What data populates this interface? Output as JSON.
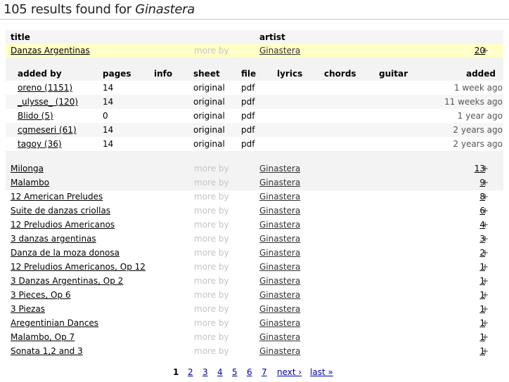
{
  "page": {
    "heading_prefix": "105 results found for ",
    "heading_query": "Ginastera"
  },
  "columns": {
    "title": "title",
    "artist": "artist"
  },
  "results": [
    {
      "title": "Danzas Argentinas",
      "more": "more by",
      "artist": "Ginastera",
      "count": "20",
      "plus": "+",
      "selected": true
    },
    {
      "title": "Milonga",
      "more": "more by",
      "artist": "Ginastera",
      "count": "13",
      "plus": "+"
    },
    {
      "title": "Malambo",
      "more": "more by",
      "artist": "Ginastera",
      "count": "9",
      "plus": "+"
    },
    {
      "title": "12 American Preludes",
      "more": "more by",
      "artist": "Ginastera",
      "count": "8",
      "plus": "+"
    },
    {
      "title": "Suite de danzas criollas",
      "more": "more by",
      "artist": "Ginastera",
      "count": "6",
      "plus": "+"
    },
    {
      "title": "12 Preludios Americanos",
      "more": "more by",
      "artist": "Ginastera",
      "count": "4",
      "plus": "+"
    },
    {
      "title": "3 danzas argentinas",
      "more": "more by",
      "artist": "Ginastera",
      "count": "3",
      "plus": "+"
    },
    {
      "title": "Danza de la moza donosa",
      "more": "more by",
      "artist": "Ginastera",
      "count": "2",
      "plus": "+"
    },
    {
      "title": "12 Preludios Americanos, Op 12",
      "more": "more by",
      "artist": "Ginastera",
      "count": "1",
      "plus": "+"
    },
    {
      "title": "3 Danzas Argentinas, Op 2",
      "more": "more by",
      "artist": "Ginastera",
      "count": "1",
      "plus": "+"
    },
    {
      "title": "3 Pieces, Op 6",
      "more": "more by",
      "artist": "Ginastera",
      "count": "1",
      "plus": "+"
    },
    {
      "title": "3 Piezas",
      "more": "more by",
      "artist": "Ginastera",
      "count": "1",
      "plus": "+"
    },
    {
      "title": "Aregentinian Dances",
      "more": "more by",
      "artist": "Ginastera",
      "count": "1",
      "plus": "+"
    },
    {
      "title": "Malambo, Op 7",
      "more": "more by",
      "artist": "Ginastera",
      "count": "1",
      "plus": "+"
    },
    {
      "title": "Sonata 1,2 and 3",
      "more": "more by",
      "artist": "Ginastera",
      "count": "1",
      "plus": "+"
    }
  ],
  "versions": {
    "headers": {
      "added_by": "added by",
      "pages": "pages",
      "info": "info",
      "sheet": "sheet",
      "file": "file",
      "lyrics": "lyrics",
      "chords": "chords",
      "guitar": "guitar",
      "added": "added"
    },
    "rows": [
      {
        "added_by": "oreno (1151)",
        "pages": "14",
        "sheet": "original",
        "file": "pdf",
        "added": "1 week ago"
      },
      {
        "added_by": "_ulysse_ (120)",
        "pages": "14",
        "sheet": "original",
        "file": "pdf",
        "added": "11 weeks ago"
      },
      {
        "added_by": "Blido (5)",
        "pages": "0",
        "sheet": "original",
        "file": "pdf",
        "added": "1 year ago"
      },
      {
        "added_by": "cgmeseri (61)",
        "pages": "14",
        "sheet": "original",
        "file": "pdf",
        "added": "2 years ago"
      },
      {
        "added_by": "tagoy (36)",
        "pages": "14",
        "sheet": "original",
        "file": "pdf",
        "added": "2 years ago"
      }
    ]
  },
  "pagination": {
    "current": "1",
    "pages": [
      "2",
      "3",
      "4",
      "5",
      "6",
      "7"
    ],
    "next": "next ›",
    "last": "last »"
  }
}
